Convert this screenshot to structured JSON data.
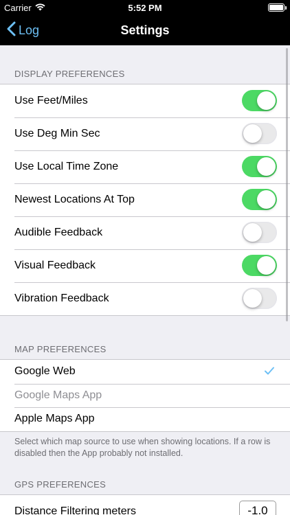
{
  "status_bar": {
    "carrier": "Carrier",
    "time": "5:52 PM",
    "wifi_icon": "wifi-icon",
    "battery_level": 1.0
  },
  "nav": {
    "back_label": "Log",
    "title": "Settings"
  },
  "colors": {
    "accent": "#6dc0f5",
    "toggle_on": "#4cd964",
    "nav_bg": "#000000",
    "page_bg": "#efeff4"
  },
  "display_preferences": {
    "header": "DISPLAY PREFERENCES",
    "items": [
      {
        "label": "Use Feet/Miles",
        "on": true
      },
      {
        "label": "Use Deg Min Sec",
        "on": false
      },
      {
        "label": "Use Local Time Zone",
        "on": true
      },
      {
        "label": "Newest Locations At Top",
        "on": true
      },
      {
        "label": "Audible Feedback",
        "on": false
      },
      {
        "label": "Visual Feedback",
        "on": true
      },
      {
        "label": "Vibration Feedback",
        "on": false
      }
    ]
  },
  "map_preferences": {
    "header": "MAP PREFERENCES",
    "items": [
      {
        "label": "Google Web",
        "selected": true,
        "enabled": true
      },
      {
        "label": "Google Maps App",
        "selected": false,
        "enabled": false
      },
      {
        "label": "Apple Maps App",
        "selected": false,
        "enabled": true
      }
    ],
    "footer": "Select which map source to use when showing locations. If a row is disabled then the App probably not installed."
  },
  "gps_preferences": {
    "header": "GPS PREFERENCES",
    "items": [
      {
        "label": "Distance Filtering meters",
        "value": "-1.0"
      }
    ]
  }
}
